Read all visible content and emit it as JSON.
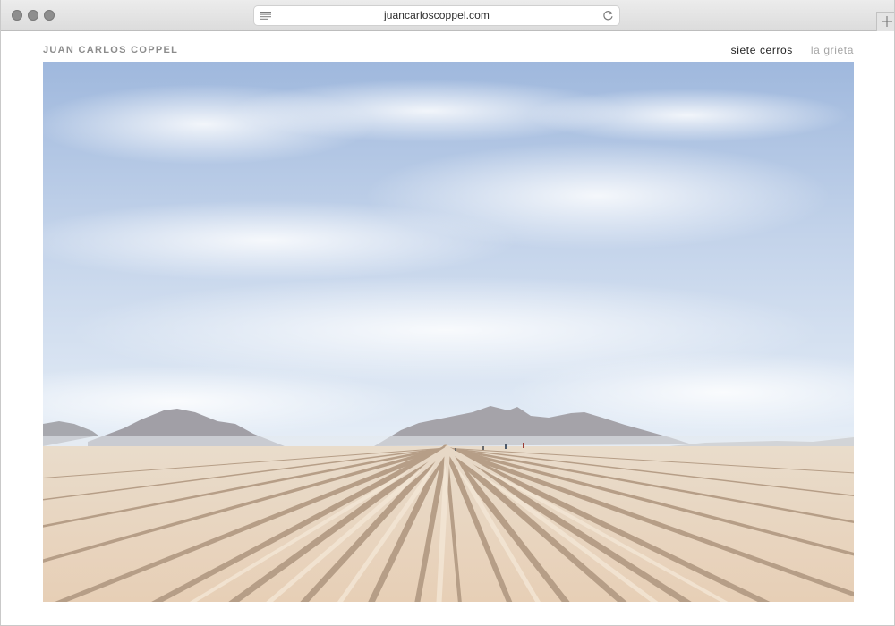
{
  "browser": {
    "url": "juancarloscoppel.com",
    "icons": {
      "reader": "reader-lines-icon",
      "reload": "reload-icon",
      "new_tab": "plus-icon"
    }
  },
  "site": {
    "title": "JUAN CARLOS COPPEL",
    "nav": [
      {
        "label": "siete cerros",
        "active": true
      },
      {
        "label": "la grieta",
        "active": false
      }
    ]
  },
  "hero": {
    "subject": "desert farm field with furrows and mountains under a pale blue sky",
    "colors": {
      "sky_top": "#9fb8dd",
      "sky_bottom": "#e6eef7",
      "mountain": "#a3a2a8",
      "soil_light": "#ecd9c3",
      "soil_shadow": "#b49d86"
    }
  }
}
